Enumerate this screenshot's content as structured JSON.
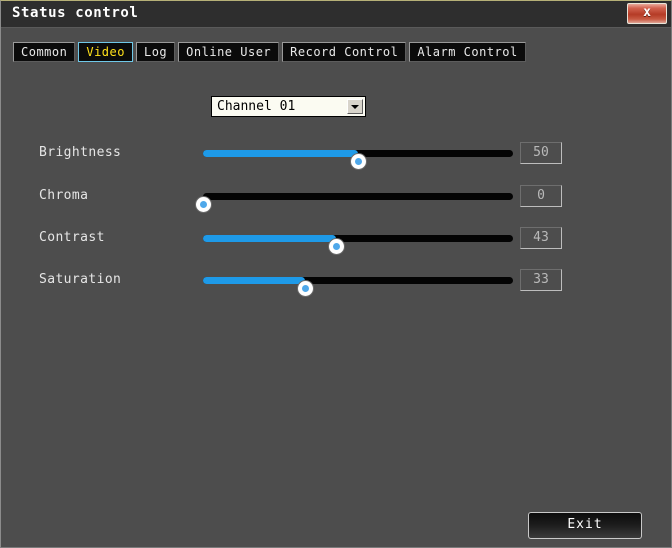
{
  "window": {
    "title": "Status control",
    "close_icon": "close-x-icon",
    "close_label": "x"
  },
  "tabs": [
    {
      "label": "Common",
      "selected": false
    },
    {
      "label": "Video",
      "selected": true
    },
    {
      "label": "Log",
      "selected": false
    },
    {
      "label": "Online User",
      "selected": false
    },
    {
      "label": "Record Control",
      "selected": false
    },
    {
      "label": "Alarm Control",
      "selected": false
    }
  ],
  "channel": {
    "label": "Channel 01",
    "arrow_icon": "chevron-down-icon",
    "options": [
      "Channel 01"
    ]
  },
  "sliders": [
    {
      "label": "Brightness",
      "value": "50",
      "percent": 50
    },
    {
      "label": "Chroma",
      "value": "0",
      "percent": 0
    },
    {
      "label": "Contrast",
      "value": "43",
      "percent": 43
    },
    {
      "label": "Saturation",
      "value": "33",
      "percent": 33
    }
  ],
  "footer": {
    "exit_label": "Exit"
  },
  "colors": {
    "accent_fill": "#1e9ae8",
    "selected_tab_text": "#ffe11a",
    "selected_tab_border": "#6fc8e8",
    "window_bg": "#4d4d4d",
    "titlebar_bg": "#2e2e2e",
    "track_bg": "#040404"
  }
}
